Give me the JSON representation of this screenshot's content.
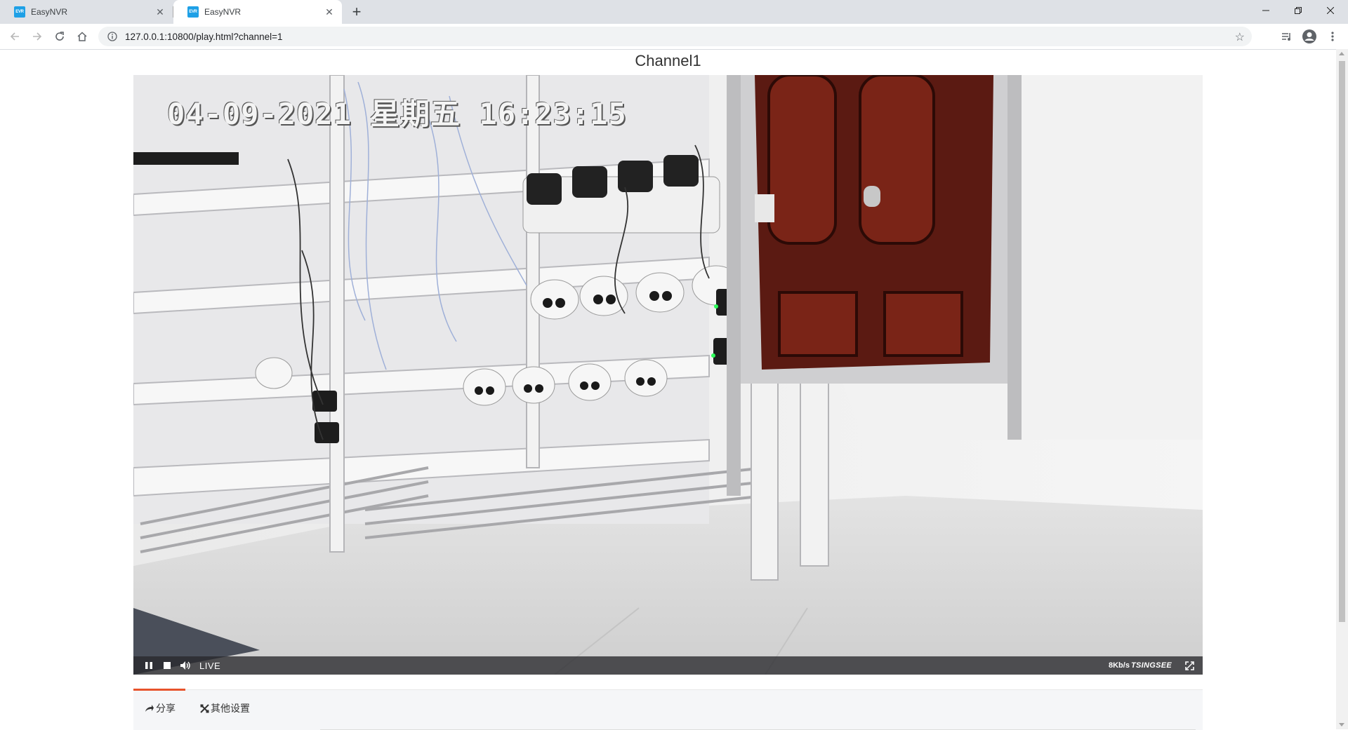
{
  "browser": {
    "tabs": [
      {
        "title": "EasyNVR",
        "favicon": "EVR",
        "active": false
      },
      {
        "title": "EasyNVR",
        "favicon": "EVR",
        "active": true
      }
    ],
    "address_url": "127.0.0.1:10800/play.html?channel=1",
    "icons": [
      "back-icon",
      "forward-icon",
      "reload-icon",
      "home-icon",
      "info-icon",
      "star-icon",
      "media-icon",
      "profile-icon",
      "menu-icon",
      "minimize-icon",
      "restore-icon",
      "close-icon",
      "new-tab-icon"
    ]
  },
  "page": {
    "channel_title": "Channel1"
  },
  "player": {
    "osd_timestamp": "04-09-2021 星期五 16:23:15",
    "live_label": "LIVE",
    "bitrate": "8Kb/s",
    "brand": "TSINGSEE",
    "controls": [
      "pause-icon",
      "stop-icon",
      "volume-icon",
      "fullscreen-icon"
    ]
  },
  "panel": {
    "tabs": [
      {
        "label": "分享",
        "icon": "share-icon",
        "active": true
      },
      {
        "label": "其他设置",
        "icon": "settings-icon",
        "active": false
      }
    ],
    "accent_color": "#e8532c"
  }
}
